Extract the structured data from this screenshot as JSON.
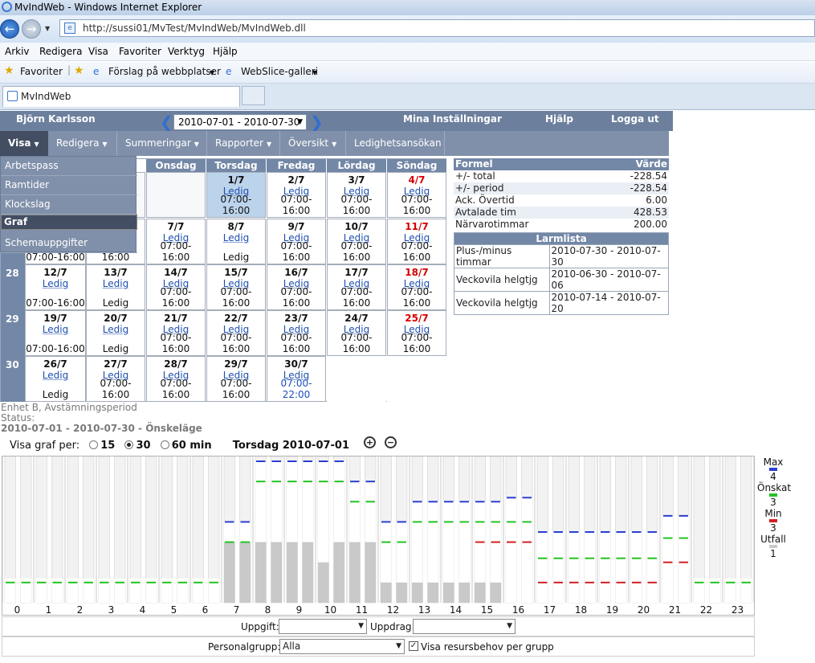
{
  "browser": {
    "title": "MvIndWeb - Windows Internet Explorer",
    "url": "http://sussi01/MvTest/MvIndWeb/MvIndWeb.dll",
    "menu": [
      "Arkiv",
      "Redigera",
      "Visa",
      "Favoriter",
      "Verktyg",
      "Hjälp"
    ],
    "favorites": {
      "favoriter": "Favoriter",
      "forslag": "Förslag på webbplatser",
      "webslice": "WebSlice-galleri"
    },
    "tab_title": "MvIndWeb"
  },
  "header": {
    "user": "Björn Karlsson",
    "period": "2010-07-01 - 2010-07-30",
    "settings": "Mina Inställningar",
    "help": "Hjälp",
    "logout": "Logga ut"
  },
  "app_menu": [
    "Visa",
    "Redigera",
    "Summeringar",
    "Rapporter",
    "Översikt",
    "Ledighetsansökan"
  ],
  "visa_dropdown": [
    "Arbetspass",
    "Ramtider",
    "Klockslag",
    "Graf",
    "Schemauppgifter"
  ],
  "calendar": {
    "day_headers": [
      "Onsdag",
      "Torsdag",
      "Fredag",
      "Lördag",
      "Söndag"
    ],
    "week_numbers": [
      "28",
      "29",
      "30"
    ],
    "rows": [
      [
        null,
        null,
        null,
        {
          "d": "1/7",
          "s": "Ledig",
          "t": "07:00-16:00",
          "today": true
        },
        {
          "d": "2/7",
          "s": "Ledig",
          "t": "07:00-16:00"
        },
        {
          "d": "3/7",
          "s": "Ledig",
          "t": "07:00-16:00"
        },
        {
          "d": "4/7",
          "s": "Ledig",
          "t": "07:00-16:00",
          "red": true
        }
      ],
      [
        {
          "t": "07:00-16:00"
        },
        {
          "t": "07:00-16:00"
        },
        {
          "d": "7/7",
          "s": "Ledig",
          "t": "07:00-16:00"
        },
        {
          "d": "8/7",
          "s": "Ledig",
          "t": "Ledig"
        },
        {
          "d": "9/7",
          "s": "Ledig",
          "t": "07:00-16:00"
        },
        {
          "d": "10/7",
          "s": "Ledig",
          "t": "07:00-16:00"
        },
        {
          "d": "11/7",
          "s": "Ledig",
          "t": "07:00-16:00",
          "red": true
        }
      ],
      [
        {
          "d": "12/7",
          "s": "Ledig",
          "t": "07:00-16:00"
        },
        {
          "d": "13/7",
          "s": "Ledig",
          "t": "Ledig"
        },
        {
          "d": "14/7",
          "s": "Ledig",
          "t": "07:00-16:00"
        },
        {
          "d": "15/7",
          "s": "Ledig",
          "t": "07:00-16:00"
        },
        {
          "d": "16/7",
          "s": "Ledig",
          "t": "07:00-16:00"
        },
        {
          "d": "17/7",
          "s": "Ledig",
          "t": "07:00-16:00"
        },
        {
          "d": "18/7",
          "s": "Ledig",
          "t": "07:00-16:00",
          "red": true
        }
      ],
      [
        {
          "d": "19/7",
          "s": "Ledig",
          "t": "07:00-16:00"
        },
        {
          "d": "20/7",
          "s": "Ledig",
          "t": "Ledig"
        },
        {
          "d": "21/7",
          "s": "Ledig",
          "t": "07:00-16:00"
        },
        {
          "d": "22/7",
          "s": "Ledig",
          "t": "07:00-16:00"
        },
        {
          "d": "23/7",
          "s": "Ledig",
          "t": "07:00-16:00"
        },
        {
          "d": "24/7",
          "s": "Ledig",
          "t": "07:00-16:00"
        },
        {
          "d": "25/7",
          "s": "Ledig",
          "t": "07:00-16:00",
          "red": true
        }
      ],
      [
        {
          "d": "26/7",
          "s": "Ledig",
          "t": "Ledig"
        },
        {
          "d": "27/7",
          "s": "Ledig",
          "t": "07:00-16:00"
        },
        {
          "d": "28/7",
          "s": "Ledig",
          "t": "07:00-16:00"
        },
        {
          "d": "29/7",
          "s": "Ledig",
          "t": "07:00-16:00"
        },
        {
          "d": "30/7",
          "s": "Ledig",
          "t": "07:00-22:00",
          "blue": true
        },
        null,
        null
      ]
    ]
  },
  "formel": {
    "head": [
      "Formel",
      "Värde"
    ],
    "rows": [
      [
        "+/- total",
        "-228.54"
      ],
      [
        "+/- period",
        "-228.54"
      ],
      [
        "Ack. Övertid",
        "6.00"
      ],
      [
        "Avtalade tim",
        "428.53"
      ],
      [
        "Närvarotimmar",
        "200.00"
      ]
    ]
  },
  "larm": {
    "title": "Larmlista",
    "rows": [
      [
        "Plus-/minus timmar",
        "2010-07-30 - 2010-07-30"
      ],
      [
        "Veckovila helgtjg",
        "2010-06-30 - 2010-07-06"
      ],
      [
        "Veckovila helgtjg",
        "2010-07-14 - 2010-07-20"
      ]
    ]
  },
  "status": {
    "line1": "Enhet B, Avstämningsperiod",
    "line2": "Status:",
    "line3": "2010-07-01 - 2010-07-30 - Önskeläge"
  },
  "graph_controls": {
    "label": "Visa graf per:",
    "opt15": "15",
    "opt30": "30",
    "opt60": "60 min",
    "selected": "30",
    "date": "Torsdag 2010-07-01"
  },
  "legend": {
    "max": "Max",
    "max_val": "4",
    "onskat": "Önskat",
    "onskat_val": "3",
    "min": "Min",
    "min_val": "3",
    "utfall": "Utfall",
    "utfall_val": "1"
  },
  "colors": {
    "max": "#2a3fd1",
    "onskat": "#22c322",
    "min": "#d12020",
    "utfall": "#c9c9c9"
  },
  "chart_data": {
    "type": "bar",
    "title": "",
    "hours": [
      "0",
      "1",
      "2",
      "3",
      "4",
      "5",
      "6",
      "7",
      "8",
      "9",
      "10",
      "11",
      "12",
      "13",
      "14",
      "15",
      "16",
      "17",
      "18",
      "19",
      "20",
      "21",
      "22",
      "23"
    ],
    "ylim": [
      0,
      7
    ],
    "slots": [
      {
        "max": null,
        "onskat": 1,
        "min": null,
        "utfall": 0
      },
      {
        "max": null,
        "onskat": 1,
        "min": null,
        "utfall": 0
      },
      {
        "max": null,
        "onskat": 1,
        "min": null,
        "utfall": 0
      },
      {
        "max": null,
        "onskat": 1,
        "min": null,
        "utfall": 0
      },
      {
        "max": null,
        "onskat": 1,
        "min": null,
        "utfall": 0
      },
      {
        "max": null,
        "onskat": 1,
        "min": null,
        "utfall": 0
      },
      {
        "max": null,
        "onskat": 1,
        "min": null,
        "utfall": 0
      },
      {
        "max": null,
        "onskat": 1,
        "min": null,
        "utfall": 0
      },
      {
        "max": null,
        "onskat": 1,
        "min": null,
        "utfall": 0
      },
      {
        "max": null,
        "onskat": 1,
        "min": null,
        "utfall": 0
      },
      {
        "max": null,
        "onskat": 1,
        "min": null,
        "utfall": 0
      },
      {
        "max": null,
        "onskat": 1,
        "min": null,
        "utfall": 0
      },
      {
        "max": null,
        "onskat": 1,
        "min": null,
        "utfall": 0
      },
      {
        "max": null,
        "onskat": 1,
        "min": null,
        "utfall": 0
      },
      {
        "max": 4,
        "onskat": 3,
        "min": null,
        "utfall": 3
      },
      {
        "max": 4,
        "onskat": 3,
        "min": null,
        "utfall": 3
      },
      {
        "max": 7,
        "onskat": 6,
        "min": null,
        "utfall": 3
      },
      {
        "max": 7,
        "onskat": 6,
        "min": null,
        "utfall": 3
      },
      {
        "max": 7,
        "onskat": 6,
        "min": null,
        "utfall": 3
      },
      {
        "max": 7,
        "onskat": 6,
        "min": null,
        "utfall": 3
      },
      {
        "max": 7,
        "onskat": 6,
        "min": null,
        "utfall": 2
      },
      {
        "max": 7,
        "onskat": 6,
        "min": null,
        "utfall": 3
      },
      {
        "max": 6,
        "onskat": 5,
        "min": null,
        "utfall": 3
      },
      {
        "max": 6,
        "onskat": 5,
        "min": null,
        "utfall": 3
      },
      {
        "max": 4,
        "onskat": 3,
        "min": null,
        "utfall": 1
      },
      {
        "max": 4,
        "onskat": 3,
        "min": null,
        "utfall": 1
      },
      {
        "max": 5,
        "onskat": 4,
        "min": null,
        "utfall": 1
      },
      {
        "max": 5,
        "onskat": 4,
        "min": null,
        "utfall": 1
      },
      {
        "max": 5,
        "onskat": 4,
        "min": null,
        "utfall": 1
      },
      {
        "max": 5,
        "onskat": 4,
        "min": null,
        "utfall": 1
      },
      {
        "max": 5,
        "onskat": 4,
        "min": 3,
        "utfall": 1
      },
      {
        "max": 5,
        "onskat": 4,
        "min": 3,
        "utfall": 1
      },
      {
        "max": 5.2,
        "onskat": 4,
        "min": 3,
        "utfall": 0
      },
      {
        "max": 5.2,
        "onskat": 4,
        "min": 3,
        "utfall": 0
      },
      {
        "max": 3.5,
        "onskat": 2.2,
        "min": 1,
        "utfall": 0
      },
      {
        "max": 3.5,
        "onskat": 2.2,
        "min": 1,
        "utfall": 0
      },
      {
        "max": 3.5,
        "onskat": 2.2,
        "min": 1,
        "utfall": 0
      },
      {
        "max": 3.5,
        "onskat": 2.2,
        "min": 1,
        "utfall": 0
      },
      {
        "max": 3.5,
        "onskat": 2.2,
        "min": 1,
        "utfall": 0
      },
      {
        "max": 3.5,
        "onskat": 2.2,
        "min": 1,
        "utfall": 0
      },
      {
        "max": 3.5,
        "onskat": 2.2,
        "min": 1,
        "utfall": 0
      },
      {
        "max": 3.5,
        "onskat": 2.2,
        "min": 1,
        "utfall": 0
      },
      {
        "max": 4.3,
        "onskat": 3.2,
        "min": 2,
        "utfall": 0
      },
      {
        "max": 4.3,
        "onskat": 3.2,
        "min": 2,
        "utfall": 0
      },
      {
        "max": null,
        "onskat": 1,
        "min": null,
        "utfall": 0
      },
      {
        "max": null,
        "onskat": 1,
        "min": null,
        "utfall": 0
      },
      {
        "max": null,
        "onskat": 1,
        "min": null,
        "utfall": 0
      },
      {
        "max": null,
        "onskat": 1,
        "min": null,
        "utfall": 0
      }
    ]
  },
  "filters": {
    "uppgift_label": "Uppgift:",
    "uppgift_value": "",
    "uppdrag_label": "Uppdrag:",
    "uppdrag_value": "",
    "personalgrupp_label": "Personalgrupp:",
    "personalgrupp_value": "Alla",
    "visa_resurs": "Visa resursbehov per grupp",
    "visa_resurs_checked": true
  }
}
